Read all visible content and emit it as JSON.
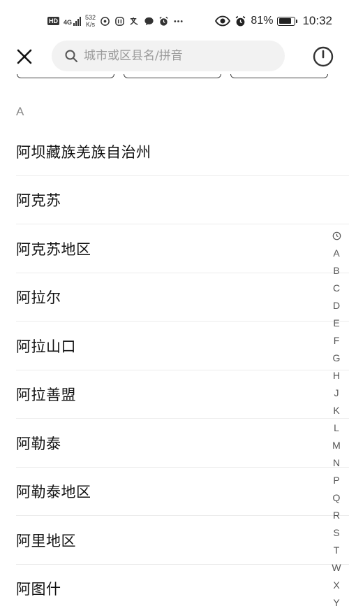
{
  "status_bar": {
    "hd_label": "HD",
    "network_label": "4G",
    "speed_value": "532",
    "speed_unit": "K/s",
    "battery_percent": "81%",
    "time": "10:32",
    "battery_level": 0.81,
    "left_icons": [
      "signal-bars-icon",
      "hotspot-icon",
      "app-notification-icon",
      "translate-icon",
      "chat-bubble-icon",
      "alarm-icon",
      "more-dots-icon"
    ],
    "right_icons": [
      "eye-icon",
      "alarm-icon",
      "battery-icon"
    ]
  },
  "header": {
    "close_icon": "close-icon",
    "search_placeholder": "城市或区县名/拼音",
    "search_value": "",
    "history_icon": "clock-icon"
  },
  "section": {
    "letter": "A"
  },
  "cities": [
    {
      "name": "阿坝藏族羌族自治州"
    },
    {
      "name": "阿克苏"
    },
    {
      "name": "阿克苏地区"
    },
    {
      "name": "阿拉尔"
    },
    {
      "name": "阿拉山口"
    },
    {
      "name": "阿拉善盟"
    },
    {
      "name": "阿勒泰"
    },
    {
      "name": "阿勒泰地区"
    },
    {
      "name": "阿里地区"
    },
    {
      "name": "阿图什"
    }
  ],
  "alpha_index": {
    "recent_icon": "clock-icon",
    "letters": [
      "A",
      "B",
      "C",
      "D",
      "E",
      "F",
      "G",
      "H",
      "J",
      "K",
      "L",
      "M",
      "N",
      "P",
      "Q",
      "R",
      "S",
      "T",
      "W",
      "X",
      "Y"
    ]
  },
  "colors": {
    "background": "#ffffff",
    "search_bg": "#f2f2f2",
    "placeholder": "#9a9a9a",
    "divider": "#ececec",
    "section_letter": "#8a8a8a"
  }
}
